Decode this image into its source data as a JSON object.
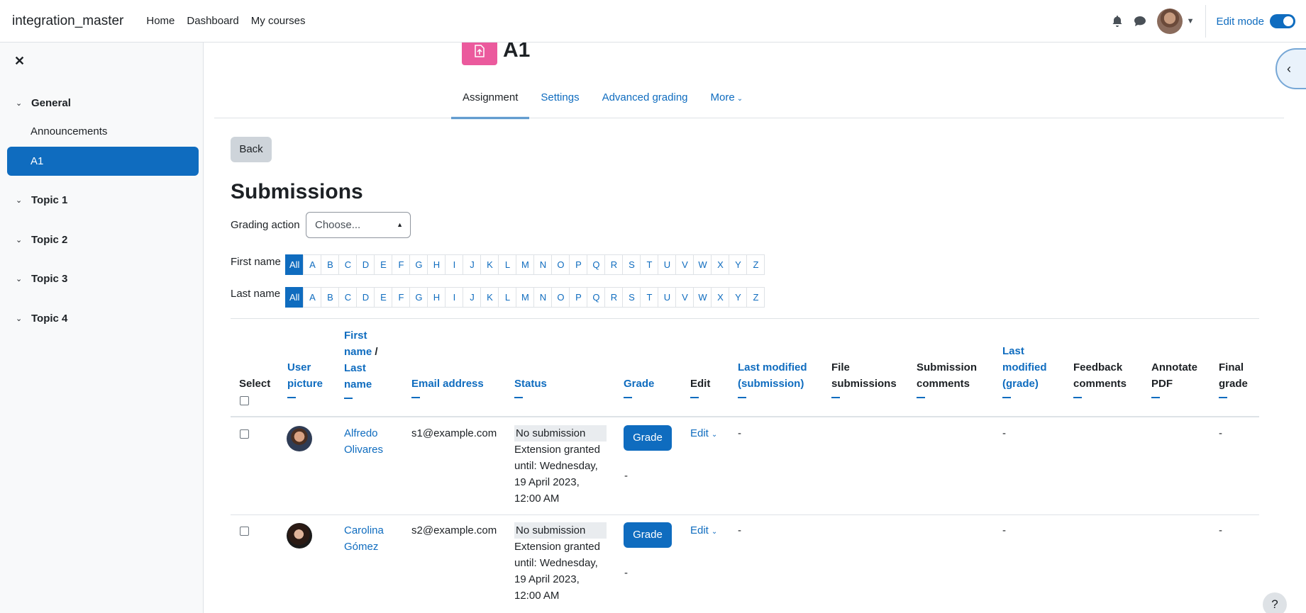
{
  "navbar": {
    "brand": "integration_master",
    "links": [
      "Home",
      "Dashboard",
      "My courses"
    ],
    "edit_mode_label": "Edit mode"
  },
  "drawer": {
    "close_glyph": "✕",
    "sections": [
      {
        "label": "General",
        "items": [
          "Announcements",
          "A1"
        ],
        "active_item": "A1"
      },
      {
        "label": "Topic 1"
      },
      {
        "label": "Topic 2"
      },
      {
        "label": "Topic 3"
      },
      {
        "label": "Topic 4"
      }
    ]
  },
  "activity": {
    "title": "A1",
    "icon": "assignment-icon",
    "icon_color": "#e83e8c",
    "tabs": [
      "Assignment",
      "Settings",
      "Advanced grading",
      "More"
    ],
    "active_tab": "Assignment"
  },
  "page": {
    "back_label": "Back",
    "heading": "Submissions",
    "grading_action_label": "Grading action",
    "grading_action_value": "Choose...",
    "first_name_label": "First name",
    "last_name_label": "Last name",
    "initials": [
      "All",
      "A",
      "B",
      "C",
      "D",
      "E",
      "F",
      "G",
      "H",
      "I",
      "J",
      "K",
      "L",
      "M",
      "N",
      "O",
      "P",
      "Q",
      "R",
      "S",
      "T",
      "U",
      "V",
      "W",
      "X",
      "Y",
      "Z"
    ],
    "selected_initial": "All"
  },
  "table": {
    "headers": {
      "select": "Select",
      "user_picture_1": "User",
      "user_picture_2": "picture",
      "first_name_1": "First",
      "first_name_2": "name",
      "slash": " /",
      "last_name_1": "Last",
      "last_name_2": "name",
      "email": "Email address",
      "status": "Status",
      "grade": "Grade",
      "edit": "Edit",
      "last_modified_sub_1": "Last modified",
      "last_modified_sub_2": "(submission)",
      "file_sub_1": "File",
      "file_sub_2": "submissions",
      "sub_comments_1": "Submission",
      "sub_comments_2": "comments",
      "last_modified_grade_1": "Last",
      "last_modified_grade_2": "modified",
      "last_modified_grade_3": "(grade)",
      "feedback_1": "Feedback",
      "feedback_2": "comments",
      "annotate_1": "Annotate",
      "annotate_2": "PDF",
      "final_1": "Final",
      "final_2": "grade"
    },
    "rows": [
      {
        "first": "Alfredo",
        "last": "Olivares",
        "email": "s1@example.com",
        "status": "No submission",
        "extension_1": "Extension granted",
        "extension_2": "until: Wednesday,",
        "extension_3": "19 April 2023,",
        "extension_4": "12:00 AM",
        "grade_button": "Grade",
        "grade_value": "-",
        "edit": "Edit",
        "last_modified_submission": "-",
        "last_modified_grade": "-",
        "final_grade": "-"
      },
      {
        "first": "Carolina",
        "last": "Gómez",
        "email": "s2@example.com",
        "status": "No submission",
        "extension_1": "Extension granted",
        "extension_2": "until: Wednesday,",
        "extension_3": "19 April 2023,",
        "extension_4": "12:00 AM",
        "grade_button": "Grade",
        "grade_value": "-",
        "edit": "Edit",
        "last_modified_submission": "-",
        "last_modified_grade": "-",
        "final_grade": "-"
      }
    ]
  },
  "help_label": "?",
  "colors": {
    "primary": "#0f6cbf",
    "assignment": "#e83e8c"
  }
}
